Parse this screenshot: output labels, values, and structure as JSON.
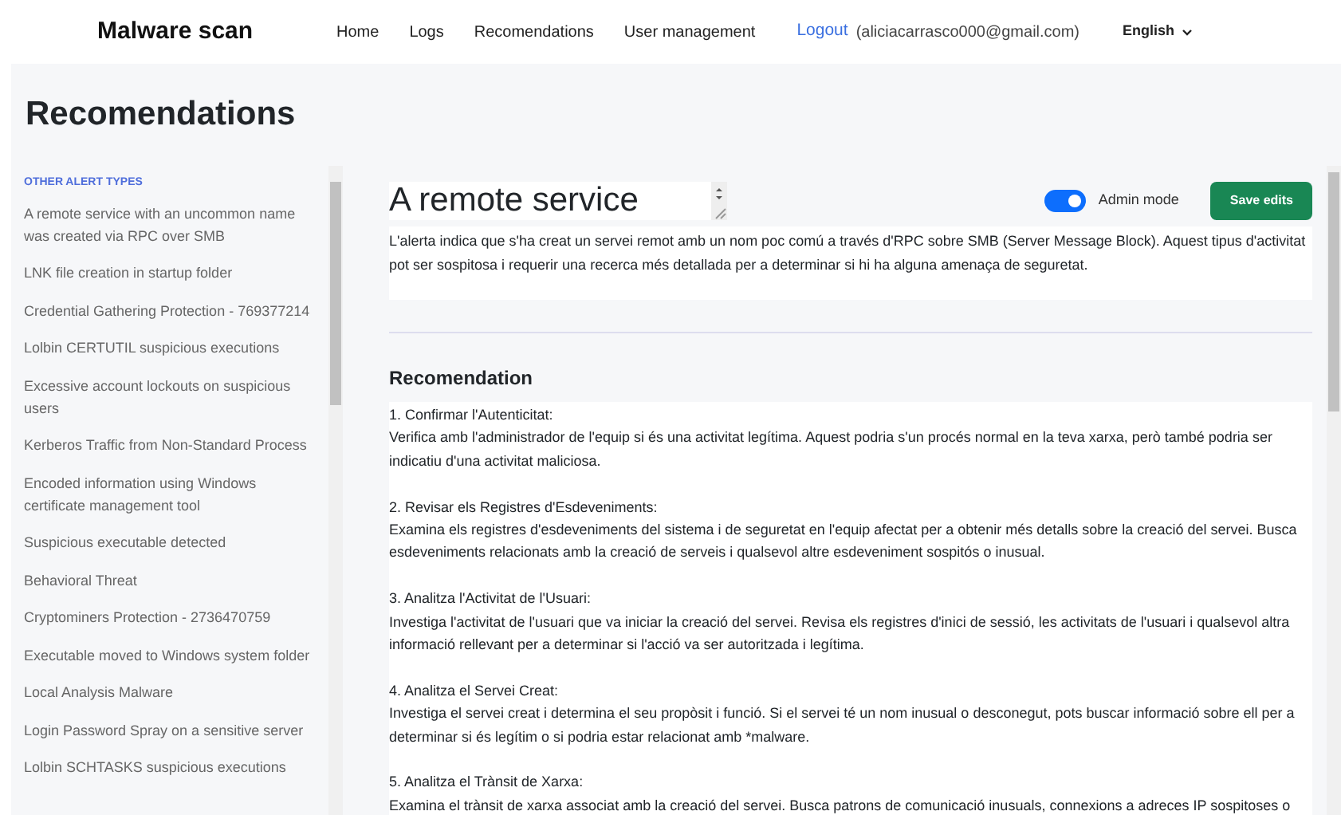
{
  "navbar": {
    "brand": "Malware scan",
    "links": [
      {
        "label": "Home",
        "selected": false
      },
      {
        "label": "Logs",
        "selected": false
      },
      {
        "label": "Recomendations",
        "selected": false
      },
      {
        "label": "User management",
        "selected": false
      }
    ],
    "logout": "Logout",
    "user": "(aliciacarrasco000@gmail.com)",
    "language": "English"
  },
  "page_title": "Recomendations",
  "sidebar": {
    "heading": "OTHER ALERT TYPES",
    "items": [
      {
        "label": "A remote service with an uncommon name was created via RPC over SMB"
      },
      {
        "label": "LNK file creation in startup folder"
      },
      {
        "label": "Credential Gathering Protection - 769377214"
      },
      {
        "label": "Lolbin CERTUTIL suspicious executions"
      },
      {
        "label": "Excessive account lockouts on suspicious users"
      },
      {
        "label": "Kerberos Traffic from Non-Standard Process"
      },
      {
        "label": "Encoded information using Windows certificate management tool"
      },
      {
        "label": "Suspicious executable detected"
      },
      {
        "label": "Behavioral Threat"
      },
      {
        "label": "Cryptominers Protection - 2736470759"
      },
      {
        "label": "Executable moved to Windows system folder"
      },
      {
        "label": "Local Analysis Malware"
      },
      {
        "label": "Login Password Spray on a sensitive server"
      },
      {
        "label": "Lolbin SCHTASKS suspicious executions"
      }
    ]
  },
  "alert": {
    "title": "A remote service",
    "admin_mode": {
      "label": "Admin mode",
      "on": true
    },
    "save_button": "Save edits",
    "description": "L'alerta indica que s'ha creat un servei remot amb un nom poc comú a través d'RPC sobre SMB (Server Message Block). Aquest tipus d'activitat pot ser sospitosa i requerir una recerca més detallada per a determinar si hi ha alguna amenaça de seguretat."
  },
  "recommendation": {
    "heading": "Recomendation",
    "steps": [
      {
        "title": "1. Confirmar l'Autenticitat:",
        "body": "Verifica amb l'administrador de l'equip si és una activitat legítima. Aquest podria s'un procés normal en la teva xarxa, però també podria ser indicatiu d'una activitat maliciosa."
      },
      {
        "title": "2. Revisar els Registres d'Esdeveniments:",
        "body": "Examina els registres d'esdeveniments del sistema i de seguretat en l'equip afectat per a obtenir més detalls sobre la creació del servei. Busca esdeveniments relacionats amb la creació de serveis i qualsevol altre esdeveniment sospitós o inusual."
      },
      {
        "title": "3. Analitza l'Activitat de l'Usuari:",
        "body": "Investiga l'activitat de l'usuari que va iniciar la creació del servei. Revisa els registres d'inici de sessió, les activitats de l'usuari i qualsevol altra informació rellevant per a determinar si l'acció va ser autoritzada i legítima."
      },
      {
        "title": "4. Analitza el Servei Creat:",
        "body": "Investiga el servei creat i determina el seu propòsit i funció. Si el servei té un nom inusual o desconegut, pots buscar informació sobre ell per a determinar si és legítim o si podria estar relacionat amb *malware."
      },
      {
        "title": "5. Analitza el Trànsit de Xarxa:",
        "body": "Examina el trànsit de xarxa associat amb la creació del servei. Busca patrons de comunicació inusuals, connexions a adreces IP sospitoses o"
      }
    ]
  }
}
